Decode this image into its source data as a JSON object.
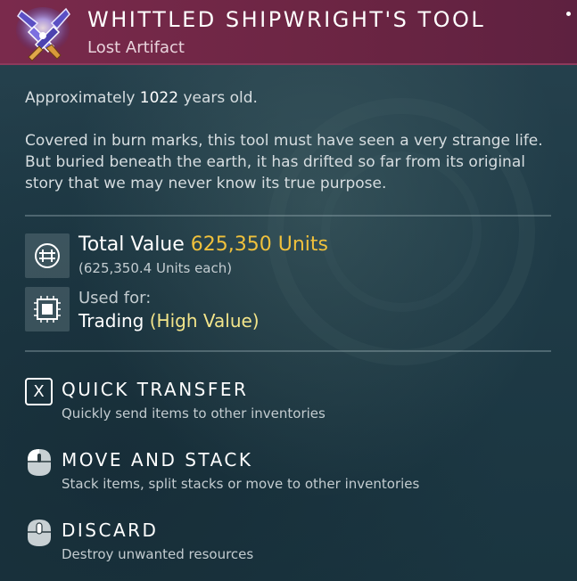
{
  "item": {
    "title": "WHITTLED SHIPWRIGHT'S TOOL",
    "category": "Lost Artifact",
    "icon": "shipwright-tool-icon",
    "header_color": "#7a2a4c"
  },
  "description": {
    "age_prefix": "Approximately",
    "age_value": "1022",
    "age_suffix": "years old.",
    "text": "Covered in burn marks, this tool must have seen a very strange life. But buried beneath the earth, it has drifted so far from its original story that we may never know its true purpose."
  },
  "value": {
    "label": "Total Value",
    "amount": "625,350 Units",
    "each": "(625,350.4 Units each)",
    "icon": "units-currency-icon",
    "amount_color": "#f0c13c"
  },
  "usage": {
    "label": "Used for:",
    "value": "Trading",
    "qualifier": "(High Value)",
    "icon": "chip-icon",
    "qualifier_color": "#f3e58a"
  },
  "actions": [
    {
      "key": "X",
      "title": "QUICK TRANSFER",
      "desc": "Quickly send items to other inventories",
      "icon": "key-x-icon"
    },
    {
      "title": "MOVE AND STACK",
      "desc": "Stack items, split stacks or move to other inventories",
      "icon": "mouse-left-click-icon"
    },
    {
      "title": "DISCARD",
      "desc": "Destroy unwanted resources",
      "icon": "mouse-middle-click-icon"
    }
  ]
}
